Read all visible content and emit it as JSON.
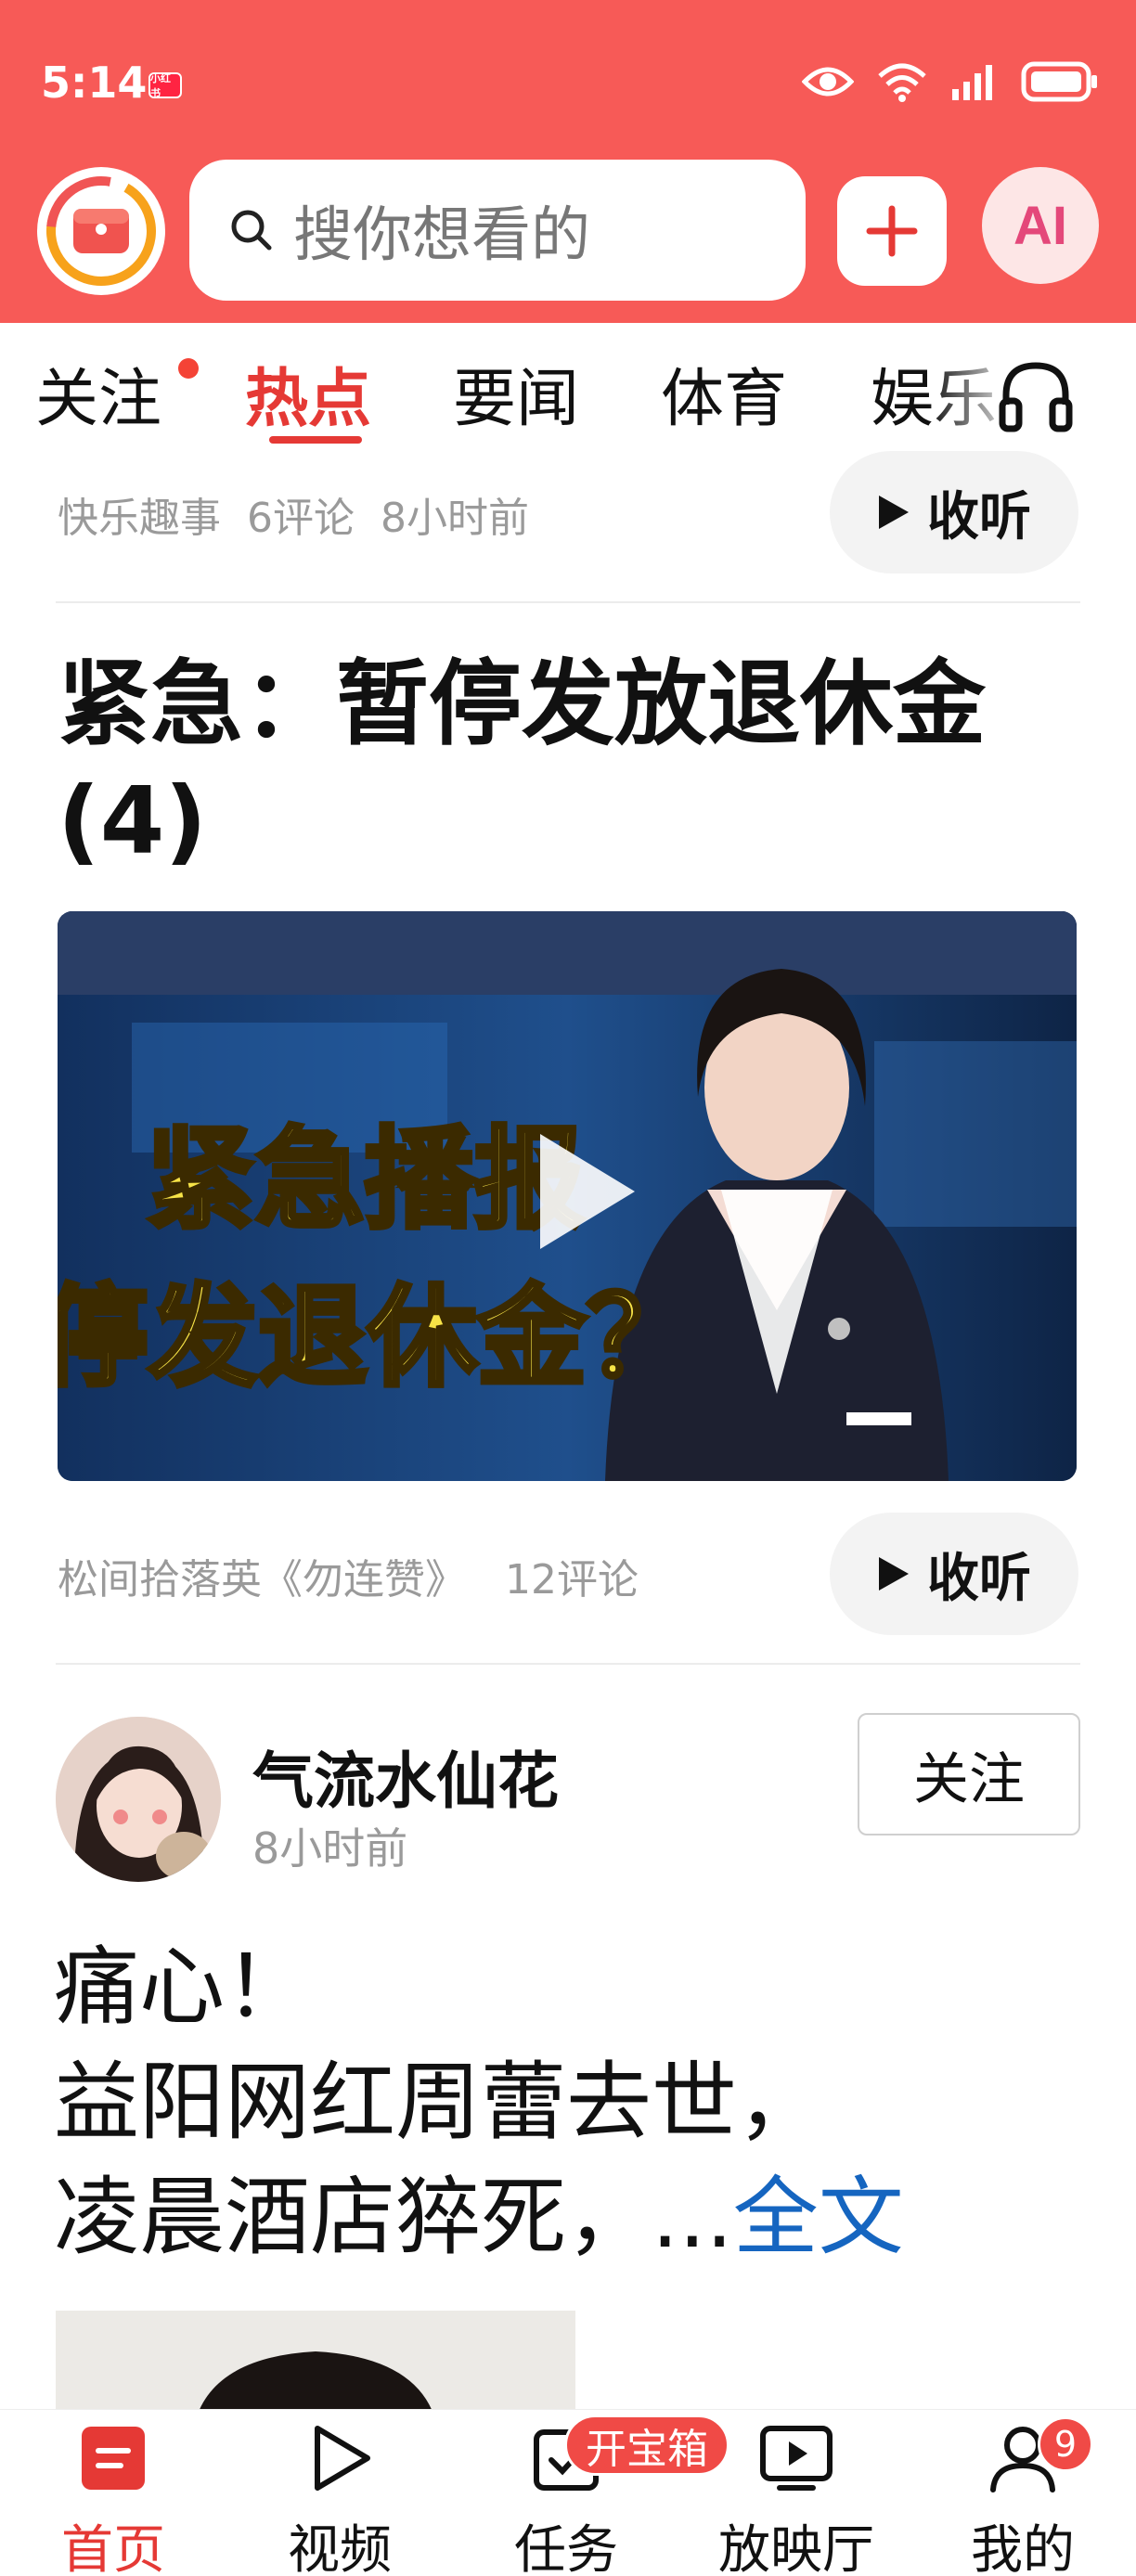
{
  "status_bar": {
    "time": "5:14",
    "mini_badge": "小红书"
  },
  "header": {
    "search_placeholder": "搜你想看的",
    "ai_label": "AI",
    "accent": "#f75a57"
  },
  "tabs": [
    {
      "label": "关注",
      "has_dot": true
    },
    {
      "label": "热点",
      "active": true
    },
    {
      "label": "要闻"
    },
    {
      "label": "体育"
    },
    {
      "label": "娱乐"
    }
  ],
  "feed": {
    "item1": {
      "source": "快乐趣事",
      "comments": "6评论",
      "time": "8小时前",
      "listen_label": "收听"
    },
    "item2": {
      "title": "紧急：暂停发放退休金(4)",
      "video_overlay_line1": "紧急播报",
      "video_overlay_line2": "停发退休金？",
      "source": "松间拾落英《勿连赞》",
      "comments": "12评论",
      "listen_label": "收听"
    },
    "item3": {
      "author": "气流水仙花",
      "time": "8小时前",
      "follow_label": "关注",
      "text_line1": "痛心！",
      "text_line2": "益阳网红周蕾去世，",
      "text_line3": "凌晨酒店猝死，...",
      "more_label": "全文"
    }
  },
  "bottom_nav": {
    "items": [
      {
        "label": "首页",
        "icon": "home-icon",
        "active": true
      },
      {
        "label": "视频",
        "icon": "video-play-icon"
      },
      {
        "label": "任务",
        "icon": "task-icon"
      },
      {
        "label": "放映厅",
        "icon": "cinema-icon"
      },
      {
        "label": "我的",
        "icon": "profile-icon"
      }
    ],
    "task_badge": "开宝箱",
    "profile_badge": "9"
  }
}
